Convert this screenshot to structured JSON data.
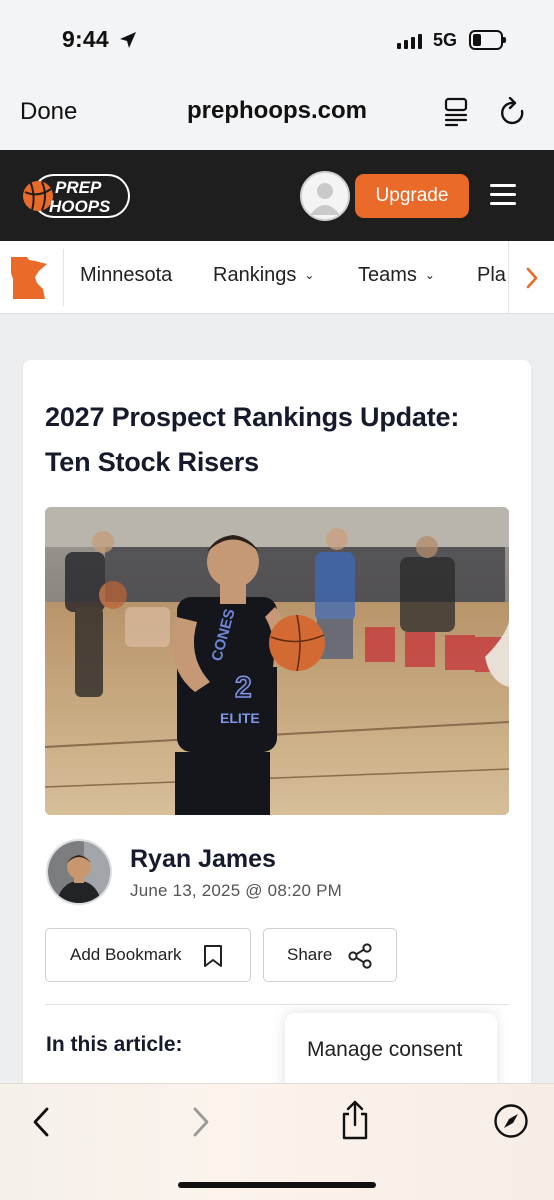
{
  "status_bar": {
    "time": "9:44",
    "network": "5G"
  },
  "browser": {
    "done_label": "Done",
    "host": "prephoops.com"
  },
  "site": {
    "logo_line1": "PREP",
    "logo_line2": "HOOPS",
    "upgrade_label": "Upgrade",
    "brand_color": "#ea6a2a"
  },
  "nav": {
    "items": [
      {
        "label": "Minnesota",
        "has_dropdown": false
      },
      {
        "label": "Rankings",
        "has_dropdown": true
      },
      {
        "label": "Teams",
        "has_dropdown": true
      },
      {
        "label": "Pla",
        "has_dropdown": false
      }
    ]
  },
  "article": {
    "title": "2027 Prospect Rankings Update: Ten Stock Risers",
    "jersey_text": "CONES ELITE",
    "author": "Ryan James",
    "date": "June 13, 2025 @ 08:20 PM",
    "bookmark_label": "Add Bookmark",
    "share_label": "Share",
    "toc_heading": "In this article:"
  },
  "consent": {
    "label": "Manage consent"
  },
  "icons": {
    "location": "location-arrow-icon",
    "reader": "reader-mode-icon",
    "reload": "reload-icon",
    "bookmark": "bookmark-icon",
    "share": "share-nodes-icon",
    "back": "back-chevron-icon",
    "forward": "forward-chevron-icon",
    "action": "share-sheet-icon",
    "safari": "compass-icon"
  }
}
